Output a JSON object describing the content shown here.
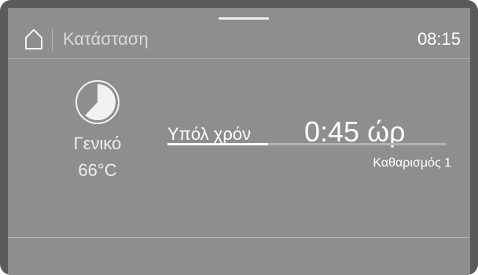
{
  "header": {
    "home_icon": "home-icon",
    "title": "Κατάσταση",
    "time": "08:15"
  },
  "program": {
    "icon": "pie-progress-icon",
    "name": "Γενικό",
    "temperature": "66°C"
  },
  "remaining": {
    "label": "Υπόλ χρόν",
    "value": "0:45 ώρ",
    "progress_fraction": 0.36
  },
  "phase": {
    "text": "Καθαρισμός 1"
  },
  "colors": {
    "screen_bg": "#8e8e8e",
    "bezel": "#5a5a5a",
    "text": "#ffffff",
    "progress_track": "#b2b2b2",
    "progress_fill": "#ffffff"
  }
}
